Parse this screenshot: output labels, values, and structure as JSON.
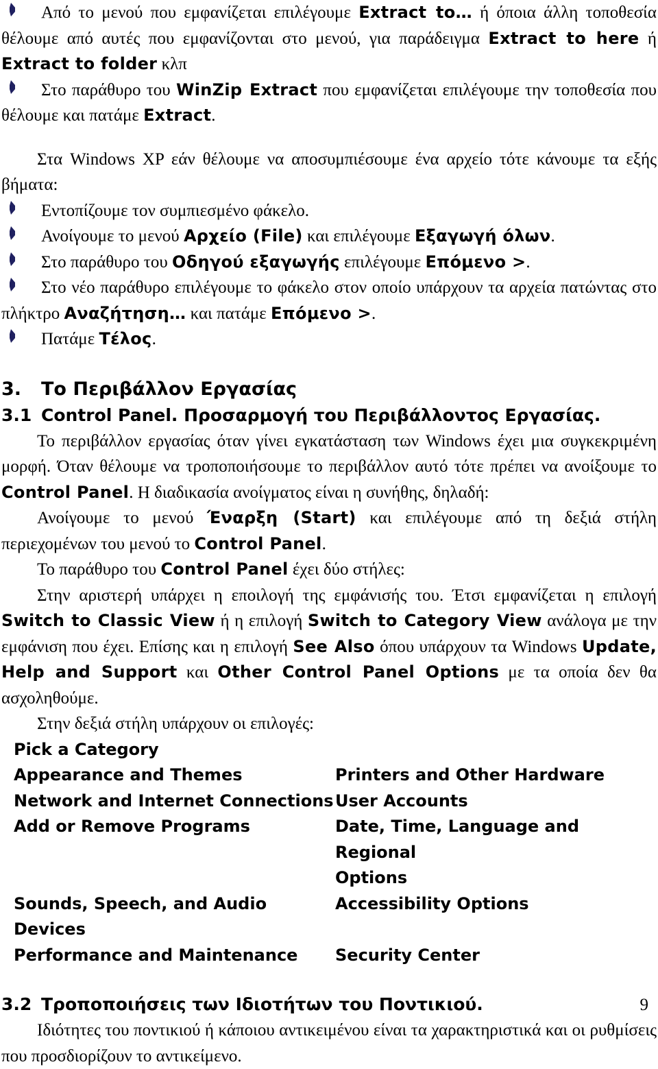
{
  "page": {
    "number": "9",
    "bullet_color": "#1f2060"
  },
  "blocks": {
    "winzip_bullet_1": {
      "lead": "Από το μενού που εμφανίζεται επιλέγουμε ",
      "em1": "Extract to…",
      "mid1": " ή όποια άλλη τοποθεσία θέλουμε από αυτές που εμφανίζονται στο μενού, για παράδειγμα ",
      "em2": "Extract to here",
      "mid2": " ή ",
      "em3": "Extract to folder",
      "tail": " κλπ"
    },
    "winzip_bullet_2": {
      "lead": "Στο παράθυρο του ",
      "em1": "WinZip Extract",
      "mid1": " που εμφανίζεται επιλέγουμε την τοποθεσία που θέλουμε και πατάμε ",
      "em2": "Extract",
      "tail": "."
    },
    "xp_intro": "Στα Windows XP εάν θέλουμε να αποσυμπιέσουμε ένα αρχείο τότε κάνουμε τα εξής βήματα:",
    "xp_steps": [
      {
        "lead": "Εντοπίζουμε τον συμπιεσμένο φάκελο.",
        "em1": "",
        "mid1": "",
        "em2": "",
        "mid2": "",
        "em3": "",
        "tail": ""
      },
      {
        "lead": "Ανοίγουμε το μενού ",
        "em1": "Αρχείο (File)",
        "mid1": " και επιλέγουμε ",
        "em2": "Εξαγωγή όλων",
        "mid2": "",
        "em3": "",
        "tail": "."
      },
      {
        "lead": "Στο παράθυρο του ",
        "em1": "Οδηγού εξαγωγής",
        "mid1": " επιλέγουμε ",
        "em2": "Επόμενο >",
        "mid2": "",
        "em3": "",
        "tail": "."
      },
      {
        "lead": "Στο νέο παράθυρο επιλέγουμε το φάκελο στον οποίο υπάρχουν τα αρχεία πατώντας στο πλήκτρο ",
        "em1": "Αναζήτηση…",
        "mid1": " και πατάμε ",
        "em2": "Επόμενο >",
        "mid2": "",
        "em3": "",
        "tail": "."
      },
      {
        "lead": "Πατάμε ",
        "em1": "Τέλος",
        "mid1": "",
        "em2": "",
        "mid2": "",
        "em3": "",
        "tail": "."
      }
    ],
    "heading_3": {
      "num": "3.",
      "text": "Το Περιβάλλον Εργασίας"
    },
    "heading_31": {
      "num": "3.1",
      "text": "Control Panel. Προσαρμογή του Περιβάλλοντος Εργασίας."
    },
    "para_31_a": {
      "lead": "Το περιβάλλον εργασίας όταν γίνει εγκατάσταση των Windows έχει μια συγκεκριμένη μορφή. Όταν θέλουμε να τροποποιήσουμε το περιβάλλον αυτό τότε πρέπει να ανοίξουμε το ",
      "em1": "Control Panel",
      "tail": ". Η διαδικασία ανοίγματος είναι η συνήθης, δηλαδή:"
    },
    "para_31_b": {
      "lead": "Ανοίγουμε το μενού ",
      "em1": "Έναρξη (Start)",
      "mid1": " και επιλέγουμε από τη δεξιά στήλη περιεχομένων του μενού το ",
      "em2": "Control Panel",
      "tail": "."
    },
    "para_31_c": {
      "lead": "Το παράθυρο του ",
      "em1": "Control Panel",
      "tail": " έχει δύο στήλες:"
    },
    "para_31_d": {
      "lead": "Στην αριστερή υπάρχει η εποιλογή της εμφάνισής του. Έτσι εμφανίζεται η επιλογή ",
      "em1": "Switch to Classic View",
      "mid1": " ή η επιλογή ",
      "em2": "Switch to Category View",
      "mid2": " ανάλογα με την εμφάνιση που έχει. Επίσης και η επιλογή ",
      "em3": "See Also",
      "mid3": " όπου υπάρχουν τα Windows ",
      "em4": "Update, Help and Support",
      "mid4": " και ",
      "em5": "Other Control Panel Options",
      "tail": " με τα οποία δεν θα ασχοληθούμε."
    },
    "para_31_e": "Στην δεξιά στήλη υπάρχουν οι επιλογές:",
    "categories": {
      "heading": "Pick a Category",
      "rows": [
        {
          "left": "Appearance and Themes",
          "right": "Printers and Other Hardware"
        },
        {
          "left": "Network and Internet Connections",
          "right": "User Accounts"
        },
        {
          "left": "Add or Remove Programs",
          "right": "Date, Time, Language and Regional"
        },
        {
          "left": "",
          "right": "Options"
        },
        {
          "left": "Sounds, Speech, and Audio Devices",
          "right": "Accessibility Options"
        },
        {
          "left": "Performance and Maintenance",
          "right": "Security Center"
        }
      ]
    },
    "heading_32": {
      "num": "3.2",
      "text": "Τροποποιήσεις των Ιδιοτήτων του Ποντικιού."
    },
    "para_32": "Ιδιότητες του ποντικιού ή κάποιου αντικειμένου είναι τα χαρακτηριστικά και οι ρυθμίσεις που προσδιορίζουν το αντικείμενο."
  }
}
